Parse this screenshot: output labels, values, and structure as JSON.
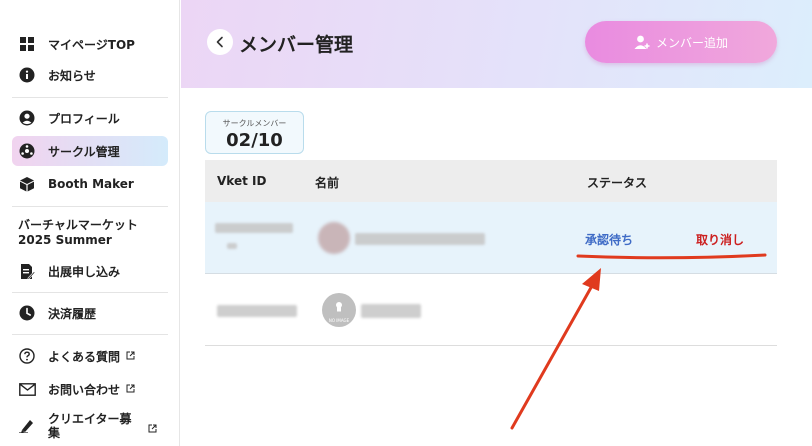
{
  "sidebar": {
    "items": [
      {
        "label": "マイページTOP",
        "icon": "grid-icon"
      },
      {
        "label": "お知らせ",
        "icon": "info-icon"
      },
      {
        "label": "プロフィール",
        "icon": "user-icon"
      },
      {
        "label": "サークル管理",
        "icon": "circle-group-icon"
      },
      {
        "label": "Booth Maker",
        "icon": "box-icon"
      },
      {
        "label": "出展申し込み",
        "icon": "document-edit-icon"
      },
      {
        "label": "決済履歴",
        "icon": "clock-icon"
      },
      {
        "label": "よくある質問",
        "icon": "question-icon"
      },
      {
        "label": "お問い合わせ",
        "icon": "mail-icon"
      },
      {
        "label": "クリエイター募集",
        "icon": "pen-icon"
      }
    ],
    "section_title_line1": "バーチャルマーケット",
    "section_title_line2": "2025 Summer"
  },
  "header": {
    "title": "メンバー管理",
    "add_button": "メンバー追加"
  },
  "member_count": {
    "label": "サークルメンバー",
    "value": "02/10"
  },
  "table": {
    "columns": [
      "Vket ID",
      "名前",
      "ステータス"
    ],
    "rows": [
      {
        "status": "承認待ち",
        "action": "取り消し"
      },
      {
        "avatar_text": "NO IMAGE"
      }
    ]
  },
  "colors": {
    "accent_pink": "#e98be0",
    "status_blue": "#3f6bc6",
    "cancel_red": "#cc1f1f",
    "annotation_red": "#e03a1e"
  }
}
